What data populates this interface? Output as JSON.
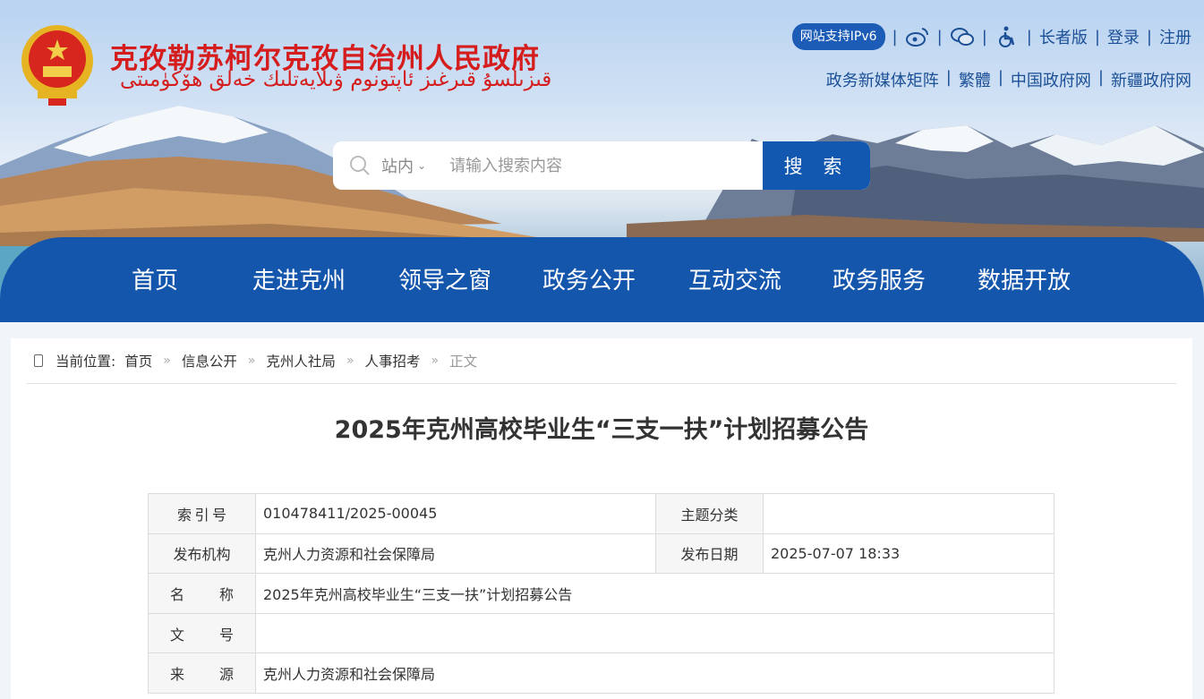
{
  "site": {
    "title": "克孜勒苏柯尔克孜自治州人民政府",
    "subtitle": "قىزىلسۇ قىرغىز ئاپتونوم ۋىلايەتلىك خەلق ھۆكۈمىتى"
  },
  "topbar": {
    "ipv6_badge": "网站支持IPv6",
    "elder": "长者版",
    "login": "登录",
    "register": "注册",
    "weibo_icon": "weibo-icon",
    "wechat_icon": "wechat-icon",
    "accessibility_icon": "wheelchair-icon"
  },
  "links": [
    "政务新媒体矩阵",
    "繁體",
    "中国政府网",
    "新疆政府网"
  ],
  "search": {
    "scope": "站内",
    "placeholder": "请输入搜索内容",
    "button": "搜 索"
  },
  "nav": [
    "首页",
    "走进克州",
    "领导之窗",
    "政务公开",
    "互动交流",
    "政务服务",
    "数据开放"
  ],
  "breadcrumb": {
    "label": "当前位置:",
    "items": [
      "首页",
      "信息公开",
      "克州人社局",
      "人事招考"
    ],
    "current": "正文"
  },
  "article": {
    "title": "2025年克州高校毕业生“三支一扶”计划招募公告"
  },
  "meta": {
    "index_label": [
      "索",
      "引",
      "号"
    ],
    "index_value": "010478411/2025-00045",
    "topic_label": "主题分类",
    "topic_value": "",
    "org_label": "发布机构",
    "org_value": "克州人力资源和社会保障局",
    "date_label": "发布日期",
    "date_value": "2025-07-07 18:33",
    "name_label": [
      "名",
      "称"
    ],
    "name_value": "2025年克州高校毕业生“三支一扶”计划招募公告",
    "docno_label": [
      "文",
      "号"
    ],
    "docno_value": "",
    "source_label": [
      "来",
      "源"
    ],
    "source_value": "克州人力资源和社会保障局"
  },
  "colors": {
    "brand_red": "#d51d1d",
    "nav_blue": "#1556ad",
    "link_blue": "#1b4f96"
  }
}
